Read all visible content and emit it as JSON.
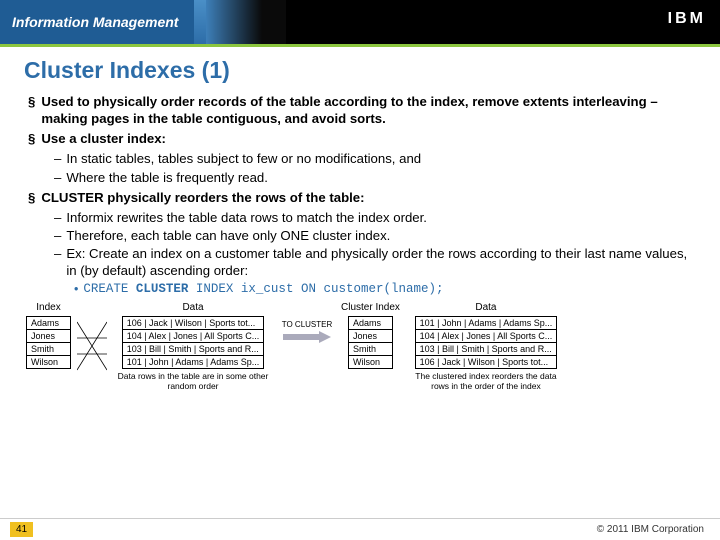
{
  "header": {
    "product": "Information Management",
    "logo": "IBM"
  },
  "title": "Cluster Indexes (1)",
  "bullets": {
    "b1a": "Used to physically order records of the table according to the index, remove extents interleaving – making pages in the table contiguous, and avoid sorts.",
    "b1b": "Use a cluster index:",
    "b2a": "In static tables, tables subject to few or no modifications, and",
    "b2b": "Where the table is frequently read.",
    "b1c": "CLUSTER physically reorders the rows of the table:",
    "b2c": "Informix rewrites the table data rows to match the index order.",
    "b2d": "Therefore, each table can have only ONE cluster index.",
    "b2e": "Ex: Create an index on a customer table and physically order the rows according to their last name values, in (by default) ascending order:",
    "b3a_pre": "CREATE ",
    "b3a_kw": "CLUSTER",
    "b3a_post": " INDEX ix_cust ON customer(lname);"
  },
  "diagram": {
    "index_label": "Index",
    "data_label": "Data",
    "cluster_index_label": "Cluster Index",
    "data2_label": "Data",
    "to_cluster": "TO CLUSTER",
    "index_rows": [
      "Adams",
      "Jones",
      "Smith",
      "Wilson"
    ],
    "data_rows": [
      "106 | Jack  | Wilson | Sports tot...",
      "104 | Alex | Jones | All Sports C...",
      "103 | Bill  | Smith | Sports and R...",
      "101 | John | Adams | Adams Sp..."
    ],
    "cluster_rows": [
      "Adams",
      "Jones",
      "Smith",
      "Wilson"
    ],
    "data2_rows": [
      "101 | John  | Adams | Adams Sp...",
      "104 | Alex | Jones | All Sports C...",
      "103 | Bill | Smith | Sports and R...",
      "106 | Jack | Wilson | Sports tot..."
    ],
    "caption_left": "Data rows in the table are in some other random order",
    "caption_right": "The clustered index reorders the data rows in the order of the index"
  },
  "footer": {
    "page": "41",
    "copyright": "© 2011 IBM Corporation"
  }
}
